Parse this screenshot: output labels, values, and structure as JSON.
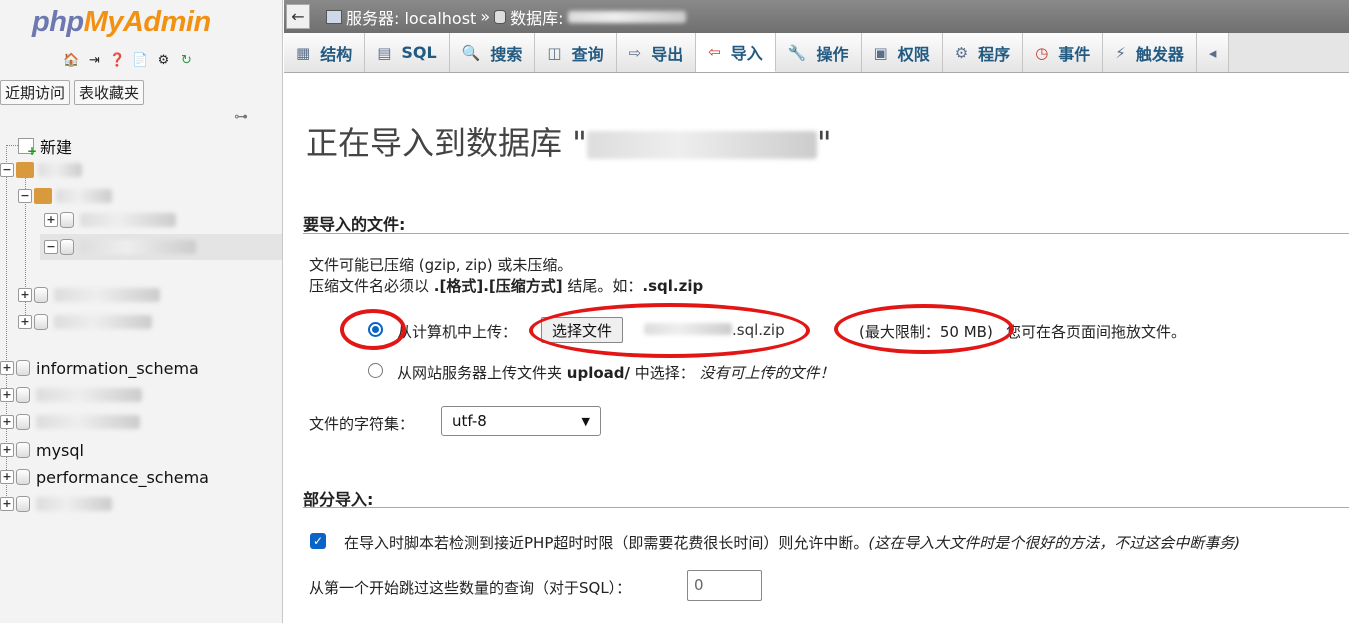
{
  "app": {
    "logo_php": "php",
    "logo_myadmin": "MyAdmin"
  },
  "nav": {
    "tab_recent": "近期访问",
    "tab_favorites": "表收藏夹",
    "new_item": "新建",
    "databases": [
      "information_schema",
      "mysql",
      "performance_schema"
    ]
  },
  "breadcrumb": {
    "server": "服务器: localhost",
    "separator": "»",
    "database": "数据库:"
  },
  "tabs": [
    {
      "label": "结构",
      "icon": "structure-icon"
    },
    {
      "label": "SQL",
      "icon": "sql-icon"
    },
    {
      "label": "搜索",
      "icon": "search-icon"
    },
    {
      "label": "查询",
      "icon": "query-icon"
    },
    {
      "label": "导出",
      "icon": "export-icon"
    },
    {
      "label": "导入",
      "icon": "import-icon",
      "active": true
    },
    {
      "label": "操作",
      "icon": "wrench-icon"
    },
    {
      "label": "权限",
      "icon": "privileges-icon"
    },
    {
      "label": "程序",
      "icon": "routines-icon"
    },
    {
      "label": "事件",
      "icon": "clock-icon"
    },
    {
      "label": "触发器",
      "icon": "triggers-icon"
    }
  ],
  "page": {
    "title_prefix": "正在导入到数据库 \"",
    "title_suffix": "\""
  },
  "file_section": {
    "heading": "要导入的文件:",
    "line1": "文件可能已压缩 (gzip, zip) 或未压缩。",
    "line2_prefix": "压缩文件名必须以 ",
    "line2_bold": ".[格式].[压缩方式]",
    "line2_mid": " 结尾。如：",
    "line2_example": ".sql.zip",
    "upload_label": "从计算机中上传：",
    "choose_file_button": "选择文件",
    "chosen_file_suffix": ".sql.zip",
    "max_limit": "(最大限制：50 MB)",
    "drag_hint": "您可在各页面间拖放文件。",
    "server_upload_prefix": "从网站服务器上传文件夹 ",
    "server_upload_folder": "upload/",
    "server_upload_mid": " 中选择：",
    "server_upload_none": "没有可上传的文件！",
    "charset_label": "文件的字符集：",
    "charset_value": "utf-8"
  },
  "partial_section": {
    "heading": "部分导入:",
    "interrupt_label": "在导入时脚本若检测到接近PHP超时时限（即需要花费很长时间）则允许中断。",
    "interrupt_hint": "(这在导入大文件时是个很好的方法，不过这会中断事务)",
    "interrupt_checked": true,
    "skip_label": "从第一个开始跳过这些数量的查询（对于SQL）：",
    "skip_value": "0"
  },
  "colors": {
    "annotation": "#e31616",
    "tab_text": "#235a81",
    "topbar": "#7a7a7a"
  }
}
